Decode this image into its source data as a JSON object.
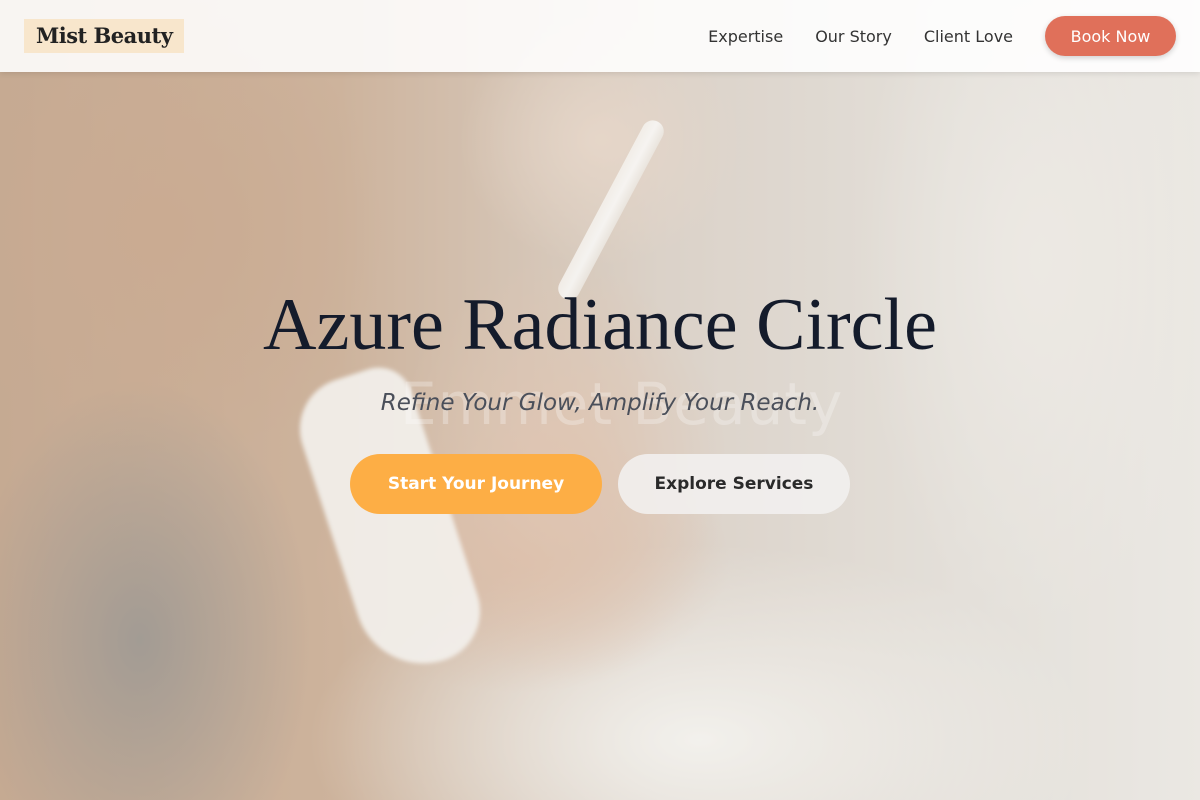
{
  "header": {
    "logo": "Mist Beauty",
    "nav": [
      {
        "label": "Expertise"
      },
      {
        "label": "Our Story"
      },
      {
        "label": "Client Love"
      }
    ],
    "book_label": "Book Now"
  },
  "hero": {
    "title": "Azure Radiance Circle",
    "subtitle": "Refine Your Glow, Amplify Your Reach.",
    "ghost_text": "Emmet Beauty",
    "primary_cta": "Start Your Journey",
    "secondary_cta": "Explore Services"
  },
  "colors": {
    "accent": "#e0705a",
    "primary_cta": "#fdae45",
    "logo_background": "#f8e6cc",
    "title": "#141b2b"
  }
}
